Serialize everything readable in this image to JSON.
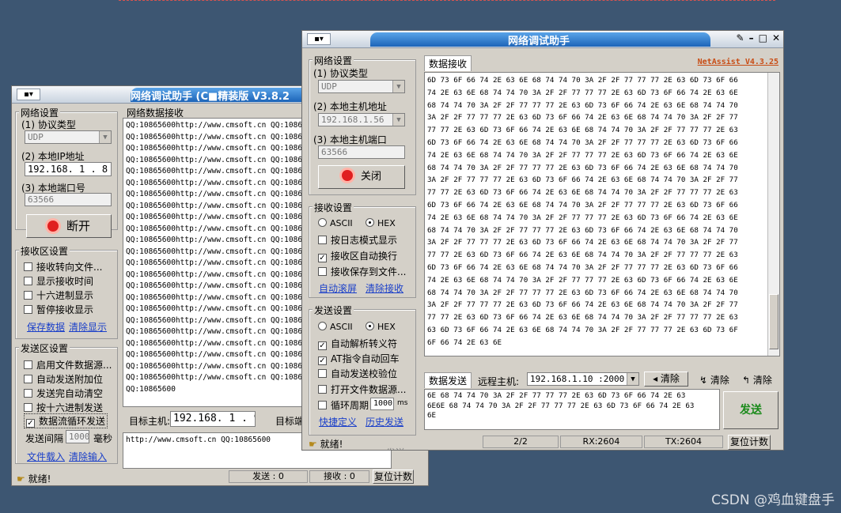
{
  "watermark": "CSDN @鸡血键盘手",
  "left": {
    "title": "网络调试助手 (C■精装版 V3.8.2",
    "net_group": "网络设置",
    "protocol_label": "(1) 协议类型",
    "protocol_value": "UDP",
    "ip_label": "(2) 本地IP地址",
    "ip_value": "192.168. 1 . 8",
    "port_label": "(3) 本地端口号",
    "port_value": "63566",
    "disconnect_label": "断开",
    "recv_group": "接收区设置",
    "recv_opts": [
      "接收转向文件...",
      "显示接收时间",
      "十六进制显示",
      "暂停接收显示"
    ],
    "save_data": "保存数据",
    "clear_display": "清除显示",
    "send_group": "发送区设置",
    "send_opts": [
      "启用文件数据源...",
      "自动发送附加位",
      "发送完自动清空",
      "按十六进制发送",
      "数据流循环发送"
    ],
    "interval_label": "发送间隔",
    "interval_value": "1000",
    "interval_unit": "毫秒",
    "file_load": "文件载入",
    "clear_input": "清除输入",
    "recv_area_title": "网络数据接收",
    "recv_lines": [
      "QQ:10865600http://www.cmsoft.cn QQ:108656",
      "QQ:10865600http://www.cmsoft.cn QQ:108656",
      "QQ:10865600http://www.cmsoft.cn QQ:108656",
      "QQ:10865600http://www.cmsoft.cn QQ:108656",
      "QQ:10865600http://www.cmsoft.cn QQ:108656",
      "QQ:10865600http://www.cmsoft.cn QQ:108656",
      "QQ:10865600http://www.cmsoft.cn QQ:108656",
      "QQ:10865600http://www.cmsoft.cn QQ:108656",
      "QQ:10865600http://www.cmsoft.cn QQ:108656",
      "QQ:10865600http://www.cmsoft.cn QQ:108656",
      "QQ:10865600http://www.cmsoft.cn QQ:108656",
      "QQ:10865600http://www.cmsoft.cn QQ:108656",
      "QQ:10865600http://www.cmsoft.cn QQ:108656",
      "QQ:10865600http://www.cmsoft.cn QQ:108656",
      "QQ:10865600http://www.cmsoft.cn QQ:108656",
      "QQ:10865600http://www.cmsoft.cn QQ:108656",
      "QQ:10865600http://www.cmsoft.cn QQ:108656",
      "QQ:10865600http://www.cmsoft.cn QQ:108656",
      "QQ:10865600http://www.cmsoft.cn QQ:108656",
      "QQ:10865600http://www.cmsoft.cn QQ:108656",
      "QQ:10865600http://www.cmsoft.cn QQ:108656",
      "QQ:10865600http://www.cmsoft.cn QQ:108656",
      "QQ:10865600http://www.cmsoft.cn QQ:108656",
      "QQ:10865600"
    ],
    "target_label": "目标主机:",
    "target_value": "192.168. 1 . 9",
    "target_port_label": "目标端",
    "send_text": "http://www.cmsoft.cn QQ:10865600",
    "status_ready": "就绪!",
    "sent_label": "发送 : 0",
    "recv_label": "接收 : 0",
    "reset_label": "复位计数"
  },
  "right": {
    "title": "网络调试助手",
    "version": "NetAssist V4.3.25",
    "net_group": "网络设置",
    "protocol_label": "(1) 协议类型",
    "protocol_value": "UDP",
    "ip_label": "(2) 本地主机地址",
    "ip_value": "192.168.1.56",
    "port_label": "(3) 本地主机端口",
    "port_value": "63566",
    "close_label": "关闭",
    "recv_group": "接收设置",
    "ascii": "ASCII",
    "hex": "HEX",
    "recv_opts": [
      {
        "label": "按日志模式显示",
        "checked": false
      },
      {
        "label": "接收区自动换行",
        "checked": true
      },
      {
        "label": "接收保存到文件...",
        "checked": false
      }
    ],
    "auto_scroll": "自动滚屏",
    "clear_recv": "清除接收",
    "send_group": "发送设置",
    "send_opts": [
      {
        "label": "自动解析转义符",
        "checked": true
      },
      {
        "label": "AT指令自动回车",
        "checked": true
      },
      {
        "label": "自动发送校验位",
        "checked": false
      },
      {
        "label": "打开文件数据源...",
        "checked": false
      }
    ],
    "cycle_label": "循环周期",
    "cycle_value": "1000",
    "cycle_unit": "ms",
    "shortcut": "快捷定义",
    "history": "历史发送",
    "recv_tab": "数据接收",
    "hex_lines": [
      "6D 73 6F 66 74 2E 63 6E 68 74 74 70 3A 2F 2F 77 77 77 2E 63 6D 73 6F 66",
      "74 2E 63 6E 68 74 74 70 3A 2F 2F 77 77 77 2E 63 6D 73 6F 66 74 2E 63 6E",
      "68 74 74 70 3A 2F 2F 77 77 77 2E 63 6D 73 6F 66 74 2E 63 6E 68 74 74 70",
      "3A 2F 2F 77 77 77 2E 63 6D 73 6F 66 74 2E 63 6E 68 74 74 70 3A 2F 2F 77",
      "77 77 2E 63 6D 73 6F 66 74 2E 63 6E 68 74 74 70 3A 2F 2F 77 77 77 2E 63",
      "6D 73 6F 66 74 2E 63 6E 68 74 74 70 3A 2F 2F 77 77 77 2E 63 6D 73 6F 66",
      "74 2E 63 6E 68 74 74 70 3A 2F 2F 77 77 77 2E 63 6D 73 6F 66 74 2E 63 6E",
      "68 74 74 70 3A 2F 2F 77 77 77 2E 63 6D 73 6F 66 74 2E 63 6E 68 74 74 70",
      "3A 2F 2F 77 77 77 2E 63 6D 73 6F 66 74 2E 63 6E 68 74 74 70 3A 2F 2F 77",
      "77 77 2E 63 6D 73 6F 66 74 2E 63 6E 68 74 74 70 3A 2F 2F 77 77 77 2E 63",
      "6D 73 6F 66 74 2E 63 6E 68 74 74 70 3A 2F 2F 77 77 77 2E 63 6D 73 6F 66",
      "74 2E 63 6E 68 74 74 70 3A 2F 2F 77 77 77 2E 63 6D 73 6F 66 74 2E 63 6E",
      "68 74 74 70 3A 2F 2F 77 77 77 2E 63 6D 73 6F 66 74 2E 63 6E 68 74 74 70",
      "3A 2F 2F 77 77 77 2E 63 6D 73 6F 66 74 2E 63 6E 68 74 74 70 3A 2F 2F 77",
      "77 77 2E 63 6D 73 6F 66 74 2E 63 6E 68 74 74 70 3A 2F 2F 77 77 77 2E 63",
      "6D 73 6F 66 74 2E 63 6E 68 74 74 70 3A 2F 2F 77 77 77 2E 63 6D 73 6F 66",
      "74 2E 63 6E 68 74 74 70 3A 2F 2F 77 77 77 2E 63 6D 73 6F 66 74 2E 63 6E",
      "68 74 74 70 3A 2F 2F 77 77 77 2E 63 6D 73 6F 66 74 2E 63 6E 68 74 74 70",
      "3A 2F 2F 77 77 77 2E 63 6D 73 6F 66 74 2E 63 6E 68 74 74 70 3A 2F 2F 77",
      "77 77 2E 63 6D 73 6F 66 74 2E 63 6E 68 74 74 70 3A 2F 2F 77 77 77 2E 63",
      "63 6D 73 6F 66 74 2E 63 6E 68 74 74 70 3A 2F 2F 77 77 77 2E 63 6D 73 6F",
      "6F 66 74 2E 63 6E"
    ],
    "send_tab": "数据发送",
    "remote_label": "远程主机:",
    "remote_value": "192.168.1.10 :2000",
    "clear1": "清除",
    "clear2": "清除",
    "clear3": "清除",
    "send_lines": [
      "6E 68 74 74 70 3A 2F 2F 77 77 77 2E 63 6D 73 6F 66 74 2E 63",
      "6E6E 68 74 74 70 3A 2F 2F 77 77 77 2E 63 6D 73 6F 66 74 2E 63",
      "6E"
    ],
    "send_btn": "发送",
    "status_ready": "就绪!",
    "page": "2/2",
    "rx": "RX:2604",
    "tx": "TX:2604",
    "reset_label": "复位计数",
    "bottom_peek": "发送"
  }
}
